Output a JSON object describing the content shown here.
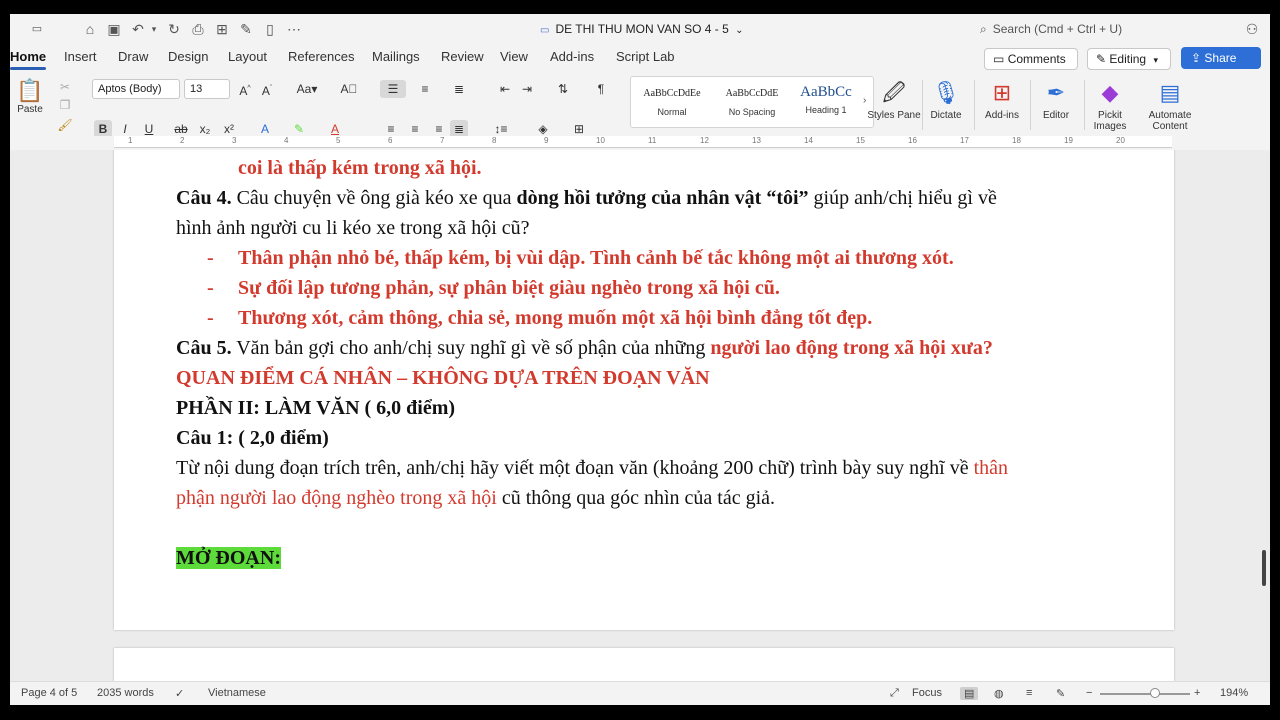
{
  "titlebar": {
    "doc_title": "DE THI THU MON VAN SO 4 - 5",
    "title_chevron": "⌄",
    "search_placeholder": "Search (Cmd + Ctrl + U)"
  },
  "tabs": [
    "Home",
    "Insert",
    "Draw",
    "Design",
    "Layout",
    "References",
    "Mailings",
    "Review",
    "View",
    "Add-ins",
    "Script Lab"
  ],
  "actions": {
    "comments": "Comments",
    "editing": "Editing",
    "share": "Share"
  },
  "ribbon": {
    "paste": "Paste",
    "font_name": "Aptos (Body)",
    "font_size": "13",
    "styles": [
      {
        "sample": "AaBbCcDdEe",
        "name": "Normal"
      },
      {
        "sample": "AaBbCcDdE",
        "name": "No Spacing"
      },
      {
        "sample": "AaBbCc",
        "name": "Heading 1"
      }
    ],
    "tools": [
      {
        "label": "Styles Pane",
        "icon": "styles-pane-icon"
      },
      {
        "label": "Dictate",
        "icon": "microphone-icon"
      },
      {
        "label": "Add-ins",
        "icon": "add-ins-grid-icon"
      },
      {
        "label": "Editor",
        "icon": "editor-pen-icon"
      },
      {
        "label": "Pickit Images",
        "icon": "pickit-icon"
      },
      {
        "label": "Automate Content",
        "icon": "automate-icon"
      }
    ]
  },
  "ruler": {
    "numbers": [
      "1",
      "2",
      "3",
      "4",
      "5",
      "6",
      "7",
      "8",
      "9",
      "10",
      "11",
      "12",
      "13",
      "14",
      "15",
      "16",
      "17",
      "18",
      "19",
      "20"
    ]
  },
  "document": {
    "line1": "coi là thấp kém trong xã hội.",
    "q4_label": "Câu 4.",
    "q4_text_a": " Câu chuyện về ông già kéo xe qua ",
    "q4_text_bold": "dòng hồi tưởng của nhân vật “tôi”",
    "q4_text_b": " giúp anh/chị hiểu gì về",
    "q4_line2": "hình ảnh người cu li kéo xe trong xã hội cũ?",
    "bullets": [
      "Thân phận nhỏ bé, thấp kém, bị vùi dập. Tình cảnh bế tắc không một ai thương xót.",
      "Sự đối lập tương phản, sự phân biệt giàu nghèo trong xã hội cũ.",
      "Thương xót, cảm thông, chia sẻ, mong muốn một xã hội bình đẳng tốt đẹp."
    ],
    "bullet_dash": "-",
    "q5_label": "Câu 5.",
    "q5_text": " Văn bản gợi cho anh/chị suy nghĩ gì về số phận của những ",
    "q5_red": "người lao động trong xã hội xưa?",
    "opinion": "QUAN ĐIỂM CÁ NHÂN – KHÔNG DỰA TRÊN ĐOẠN VĂN",
    "part2": "PHẦN II: LÀM VĂN ( 6,0 điểm)",
    "c1": "Câu 1: ( 2,0 điểm)",
    "para_a": "Từ nội dung đoạn trích trên, anh/chị hãy viết một đoạn văn (khoảng 200 chữ) trình bày suy nghĩ về ",
    "para_red1": "thân",
    "para_red2": "phận người lao động nghèo trong xã hội",
    "para_b": " cũ thông qua góc nhìn của tác giả.",
    "mo_doan": "MỞ ĐOẠN:"
  },
  "status": {
    "page": "Page 4 of 5",
    "words": "2035 words",
    "language": "Vietnamese",
    "focus": "Focus",
    "zoom": "194%"
  },
  "colors": {
    "accent": "#2d6fd6",
    "red_text": "#d23a2e",
    "highlight": "#5ddb3b"
  }
}
